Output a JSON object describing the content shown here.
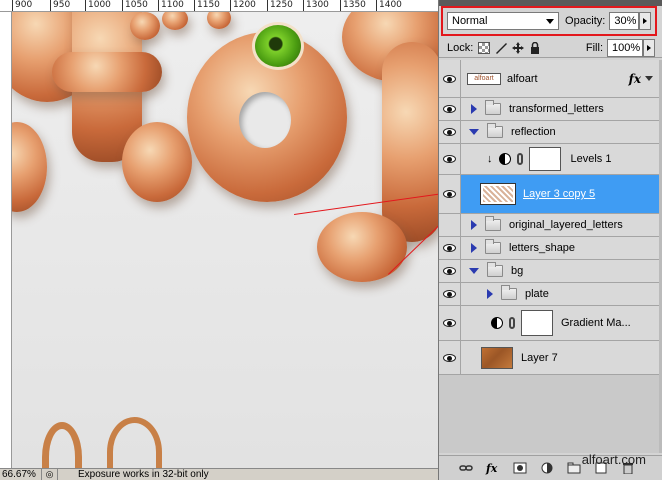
{
  "ruler": {
    "ticks": [
      "900",
      "950",
      "1000",
      "1050",
      "1100",
      "1150",
      "1200",
      "1250",
      "1300",
      "1350",
      "1400"
    ]
  },
  "status": {
    "zoom": "66.67%",
    "message": "Exposure works in 32-bit only"
  },
  "panel": {
    "blend_mode": "Normal",
    "opacity_label": "Opacity:",
    "opacity_value": "30%",
    "lock_label": "Lock:",
    "fill_label": "Fill:",
    "fill_value": "100%",
    "layers": [
      {
        "name": "alfoart",
        "type": "text-layer",
        "visible": true,
        "thumb_text": "alfoart"
      },
      {
        "name": "transformed_letters",
        "type": "group-collapsed",
        "visible": true
      },
      {
        "name": "reflection",
        "type": "group-expanded",
        "visible": true
      },
      {
        "name": "Levels 1",
        "type": "adjustment",
        "visible": true
      },
      {
        "name": "Layer 3 copy 5",
        "type": "layer-selected",
        "visible": true
      },
      {
        "name": "original_layered_letters",
        "type": "group-collapsed",
        "visible": false
      },
      {
        "name": "letters_shape",
        "type": "group-collapsed",
        "visible": true
      },
      {
        "name": "bg",
        "type": "group-expanded",
        "visible": true
      },
      {
        "name": "plate",
        "type": "group-collapsed",
        "visible": true
      },
      {
        "name": "Gradient Ma...",
        "type": "adjustment",
        "visible": true
      },
      {
        "name": "Layer 7",
        "type": "layer",
        "visible": true
      }
    ]
  },
  "watermark": "alfoart.com",
  "colors": {
    "selection": "#3f9cf3",
    "highlight": "#e3171c"
  }
}
